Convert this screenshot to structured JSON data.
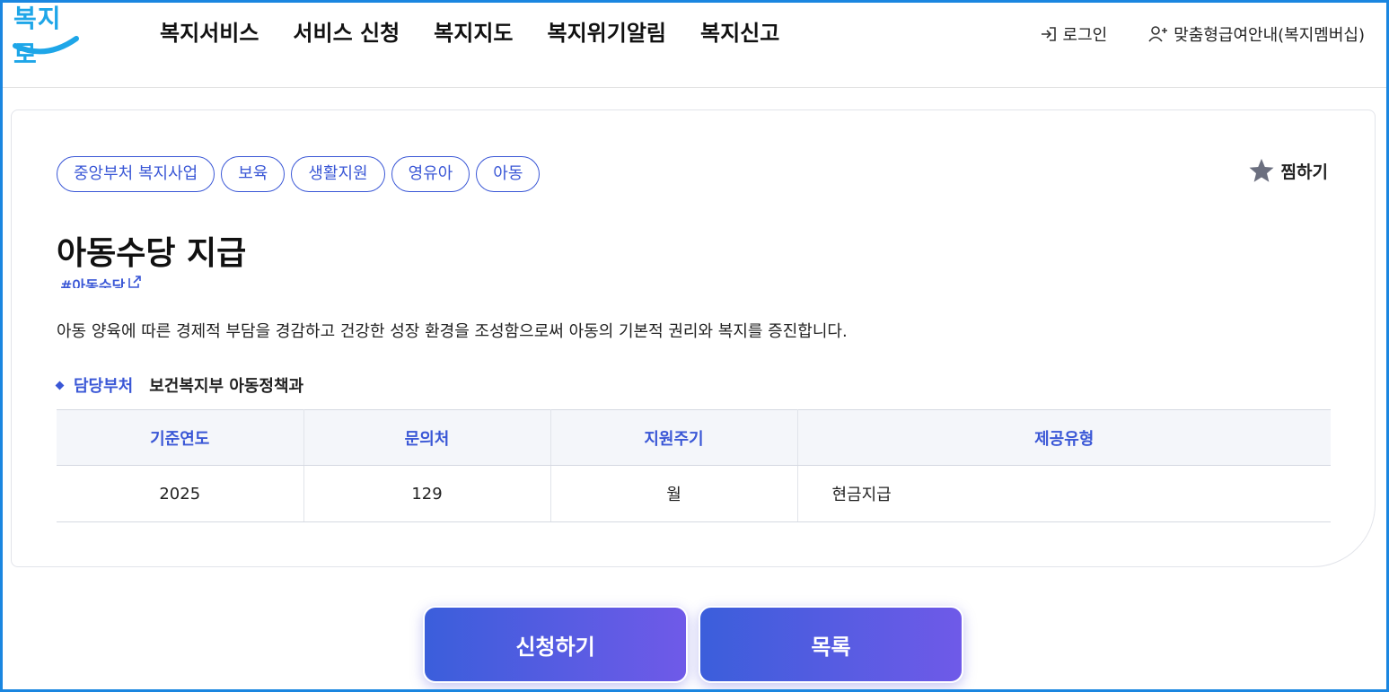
{
  "header": {
    "logo_text": "복지로",
    "nav": [
      "복지서비스",
      "서비스 신청",
      "복지지도",
      "복지위기알림",
      "복지신고"
    ],
    "login_label": "로그인",
    "membership_label": "맞춤형급여안내(복지멤버십)"
  },
  "service": {
    "tags": [
      "중앙부처 복지사업",
      "보육",
      "생활지원",
      "영유아",
      "아동"
    ],
    "bookmark_label": "찜하기",
    "title": "아동수당 지급",
    "hashtag": "#아동수당",
    "description": "아동 양육에 따른 경제적 부담을 경감하고 건강한 성장 환경을 조성함으로써 아동의 기본적 권리와 복지를 증진합니다.",
    "dept_label": "담당부처",
    "dept_value": "보건복지부 아동정책과"
  },
  "table": {
    "headers": [
      "기준연도",
      "문의처",
      "지원주기",
      "제공유형"
    ],
    "row": [
      "2025",
      "129",
      "월",
      "현금지급"
    ]
  },
  "buttons": {
    "apply_label": "신청하기",
    "list_label": "목록"
  },
  "colors": {
    "accent": "#3a57d6",
    "frame": "#1a86e0",
    "button_start": "#3b5edb",
    "button_end": "#6f5ae8"
  }
}
